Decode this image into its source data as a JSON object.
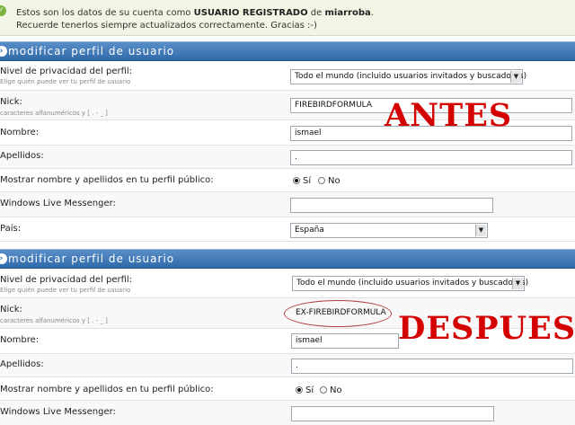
{
  "notice": {
    "line1_pre": "Estos son los datos de su cuenta como ",
    "line1_role": "USUARIO REGISTRADO",
    "line1_mid": " de ",
    "line1_site": "miarroba",
    "line1_end": ".",
    "line2": "Recuerde tenerlos siempre actualizados correctamente. Gracias :-)"
  },
  "sections": [
    {
      "header": "modificar perfil de usuario",
      "privacy_label": "Nivel de privacidad del perfil:",
      "privacy_sub": "Elige quién puede ver tu perfil de usuario",
      "privacy_value": "Todo el mundo (incluido usuarios invitados y buscadores)",
      "nick_label": "Nick:",
      "nick_sub": "caracteres alfanuméricos y [ . - _ ]",
      "nick_value": "FIREBIRDFORMULA",
      "nombre_label": "Nombre:",
      "nombre_value": "ismael",
      "apellidos_label": "Apellidos:",
      "apellidos_value": ".",
      "mostrar_label": "Mostrar nombre y apellidos en tu perfil público:",
      "si": "Sí",
      "no": "No",
      "messenger_label": "Windows Live Messenger:",
      "messenger_value": "",
      "pais_label": "País:",
      "pais_value": "España",
      "overlay": "ANTES"
    },
    {
      "header": "modificar perfil de usuario",
      "privacy_label": "Nivel de privacidad del perfil:",
      "privacy_sub": "Elige quién puede ver tu perfil de usuario",
      "privacy_value": "Todo el mundo (incluido usuarios invitados y buscadores)",
      "nick_label": "Nick:",
      "nick_sub": "caracteres alfanuméricos y [ . - _ ]",
      "nick_value": "EX-FIREBIRDFORMULA",
      "nombre_label": "Nombre:",
      "nombre_value": "ismael",
      "apellidos_label": "Apellidos:",
      "apellidos_value": ".",
      "mostrar_label": "Mostrar nombre y apellidos en tu perfil público:",
      "si": "Sí",
      "no": "No",
      "messenger_label": "Windows Live Messenger:",
      "overlay": "DESPUES"
    }
  ],
  "icons": {
    "notice": "check-circle-icon",
    "header": "arrow-right-circle-icon",
    "dropdown": "chevron-down-icon"
  },
  "colors": {
    "header_blue": "#2f6aa9",
    "overlay_red": "#d40000",
    "notice_bg": "#f4f4e4"
  }
}
